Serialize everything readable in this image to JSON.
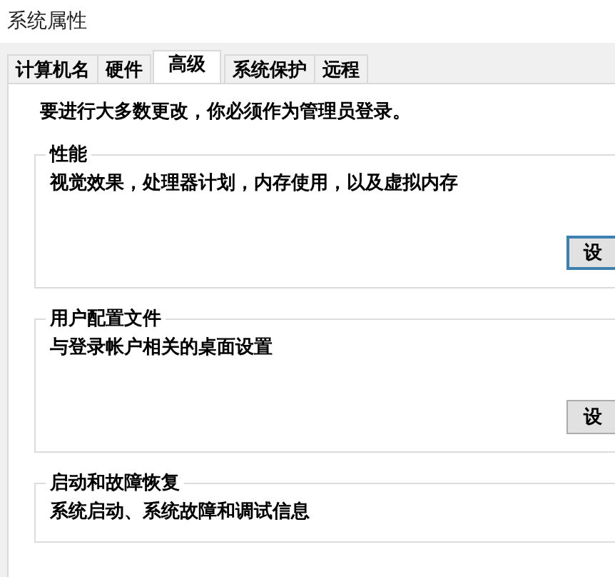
{
  "window": {
    "title": "系统属性"
  },
  "tabs": [
    {
      "label": "计算机名",
      "selected": false
    },
    {
      "label": "硬件",
      "selected": false
    },
    {
      "label": "高级",
      "selected": true
    },
    {
      "label": "系统保护",
      "selected": false
    },
    {
      "label": "远程",
      "selected": false
    }
  ],
  "notice": "要进行大多数更改，你必须作为管理员登录。",
  "groups": [
    {
      "title": "性能",
      "description": "视觉效果，处理器计划，内存使用，以及虚拟内存",
      "button": {
        "label": "设",
        "focused": true
      }
    },
    {
      "title": "用户配置文件",
      "description": "与登录帐户相关的桌面设置",
      "button": {
        "label": "设",
        "focused": false
      }
    },
    {
      "title": "启动和故障恢复",
      "description": "系统启动、系统故障和调试信息"
    }
  ]
}
